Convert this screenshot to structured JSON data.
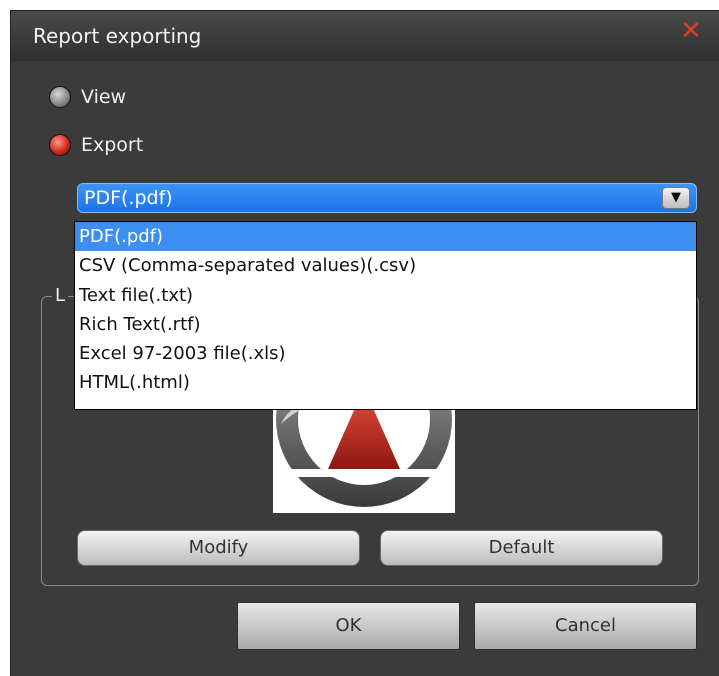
{
  "dialog": {
    "title": "Report exporting",
    "close_glyph": "✕"
  },
  "mode": {
    "view_label": "View",
    "export_label": "Export",
    "selected": "Export"
  },
  "format": {
    "selected_value": "PDF(.pdf)",
    "arrow_glyph": "▼",
    "options": [
      "PDF(.pdf)",
      "CSV (Comma-separated values)(.csv)",
      "Text file(.txt)",
      "Rich Text(.rtf)",
      "Excel 97-2003 file(.xls)",
      "HTML(.html)"
    ],
    "highlighted_index": 0
  },
  "logo_group": {
    "legend": "L",
    "modify_label": "Modify",
    "default_label": "Default"
  },
  "footer": {
    "ok_label": "OK",
    "cancel_label": "Cancel"
  },
  "colors": {
    "dialog_bg": "#3b3b3b",
    "accent_blue": "#1a73e8",
    "close_red": "#e03a2e",
    "logo_red": "#b3261e"
  },
  "icons": {
    "close": "close-icon",
    "dropdown": "chevron-down-icon",
    "logo": "logo-triangle-icon"
  }
}
